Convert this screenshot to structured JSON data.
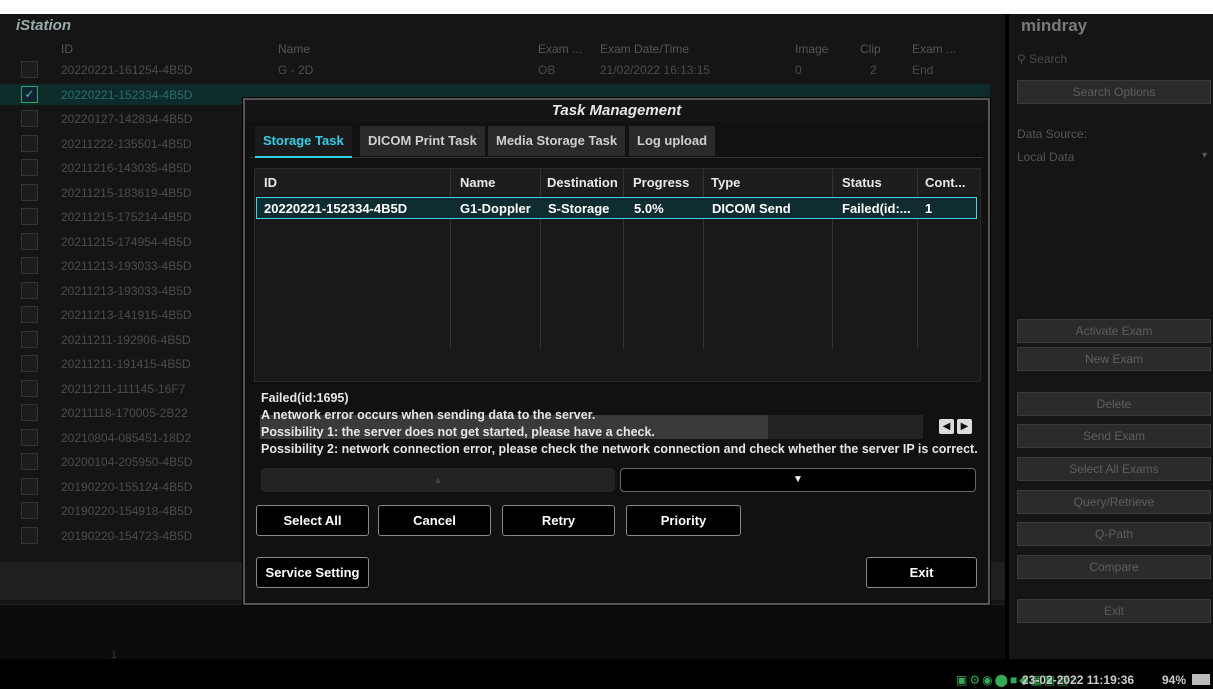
{
  "window_title": "Task Management",
  "istation": {
    "brand": "iStation",
    "headers": {
      "id": "ID",
      "name": "Name",
      "exam": "Exam ...",
      "date": "Exam Date/Time",
      "image": "Image",
      "clip": "Clip",
      "status": "Exam ..."
    },
    "rows": [
      {
        "id": "20220221-161254-4B5D",
        "name": "G - 2D",
        "exam": "OB",
        "date": "21/02/2022 16:13:15",
        "image": "0",
        "clip": "2",
        "status": "End",
        "checked": false
      },
      {
        "id": "20220221-152334-4B5D",
        "name": "",
        "exam": "",
        "date": "",
        "image": "",
        "clip": "",
        "status": "",
        "checked": true
      },
      {
        "id": "20220127-142834-4B5D",
        "name": "",
        "exam": "",
        "date": "",
        "image": "",
        "clip": "",
        "status": "",
        "checked": false
      },
      {
        "id": "20211222-135501-4B5D",
        "name": "",
        "exam": "",
        "date": "",
        "image": "",
        "clip": "",
        "status": "",
        "checked": false
      },
      {
        "id": "20211216-143035-4B5D",
        "name": "",
        "exam": "",
        "date": "",
        "image": "",
        "clip": "",
        "status": "",
        "checked": false
      },
      {
        "id": "20211215-183619-4B5D",
        "name": "",
        "exam": "",
        "date": "",
        "image": "",
        "clip": "",
        "status": "",
        "checked": false
      },
      {
        "id": "20211215-175214-4B5D",
        "name": "",
        "exam": "",
        "date": "",
        "image": "",
        "clip": "",
        "status": "",
        "checked": false
      },
      {
        "id": "20211215-174954-4B5D",
        "name": "",
        "exam": "",
        "date": "",
        "image": "",
        "clip": "",
        "status": "",
        "checked": false
      },
      {
        "id": "20211213-193033-4B5D",
        "name": "",
        "exam": "",
        "date": "",
        "image": "",
        "clip": "",
        "status": "",
        "checked": false
      },
      {
        "id": "20211213-193033-4B5D",
        "name": "",
        "exam": "",
        "date": "",
        "image": "",
        "clip": "",
        "status": "",
        "checked": false
      },
      {
        "id": "20211213-141915-4B5D",
        "name": "",
        "exam": "",
        "date": "",
        "image": "",
        "clip": "",
        "status": "",
        "checked": false
      },
      {
        "id": "20211211-192906-4B5D",
        "name": "",
        "exam": "",
        "date": "",
        "image": "",
        "clip": "",
        "status": "",
        "checked": false
      },
      {
        "id": "20211211-191415-4B5D",
        "name": "",
        "exam": "",
        "date": "",
        "image": "",
        "clip": "",
        "status": "",
        "checked": false
      },
      {
        "id": "20211211-111145-16F7",
        "name": "",
        "exam": "",
        "date": "",
        "image": "",
        "clip": "",
        "status": "",
        "checked": false
      },
      {
        "id": "20211118-170005-2B22",
        "name": "",
        "exam": "",
        "date": "",
        "image": "",
        "clip": "",
        "status": "",
        "checked": false
      },
      {
        "id": "20210804-085451-18D2",
        "name": "",
        "exam": "",
        "date": "",
        "image": "",
        "clip": "",
        "status": "",
        "checked": false
      },
      {
        "id": "20200104-205950-4B5D",
        "name": "",
        "exam": "",
        "date": "",
        "image": "",
        "clip": "",
        "status": "",
        "checked": false
      },
      {
        "id": "20190220-155124-4B5D",
        "name": "",
        "exam": "",
        "date": "",
        "image": "",
        "clip": "",
        "status": "",
        "checked": false
      },
      {
        "id": "20190220-154918-4B5D",
        "name": "",
        "exam": "",
        "date": "",
        "image": "",
        "clip": "",
        "status": "",
        "checked": false
      },
      {
        "id": "20190220-154723-4B5D",
        "name": "",
        "exam": "",
        "date": "",
        "image": "",
        "clip": "",
        "status": "",
        "checked": false
      }
    ],
    "thumb_page": "1"
  },
  "right_panel": {
    "brand": "mindray",
    "search_placeholder": "Search",
    "search_options": "Search Options",
    "data_source_label": "Data Source:",
    "data_source_value": "Local Data",
    "buttons": [
      "Activate Exam",
      "New Exam",
      "Delete",
      "Send Exam",
      "Select All Exams",
      "Query/Retrieve",
      "Q-Path",
      "Compare",
      "Exit"
    ]
  },
  "dialog": {
    "title": "Task Management",
    "tabs": [
      "Storage Task",
      "DICOM Print Task",
      "Media Storage Task",
      "Log upload"
    ],
    "active_tab": 0,
    "columns": [
      "ID",
      "Name",
      "Destination",
      "Progress",
      "Type",
      "Status",
      "Cont..."
    ],
    "rows": [
      {
        "id": "20220221-152334-4B5D",
        "name": "G1-Doppler",
        "destination": "S-Storage",
        "progress": "5.0%",
        "type": "DICOM Send",
        "status": "Failed(id:...",
        "cont": "1"
      }
    ],
    "message_lines": [
      "Failed(id:1695)",
      "A network error occurs when sending data to the server.",
      "Possibility 1: the server does not get started, please have a check.",
      "Possibility 2: network connection error, please check the network connection and check whether the server IP is correct."
    ],
    "buttons": {
      "select_all": "Select All",
      "cancel": "Cancel",
      "retry": "Retry",
      "priority": "Priority",
      "service_setting": "Service Setting",
      "exit": "Exit"
    }
  },
  "statusbar": {
    "datetime": "23-02-2022 11:19:36",
    "battery": "94%"
  },
  "colors": {
    "accent": "#2fd0e8",
    "selected_row_border": "#38d7e8",
    "dialog_bg": "#111111"
  }
}
